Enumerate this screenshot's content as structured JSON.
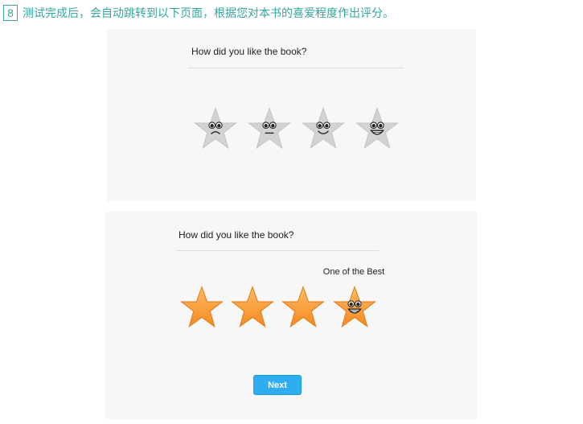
{
  "step": {
    "number": "8",
    "instruction": "测试完成后，会自动跳转到以下页面，根据您对本书的喜爱程度作出评分。"
  },
  "panel_before": {
    "question": "How did you like the book?",
    "rating": 0,
    "max_rating": 4,
    "star_color": "#d2d2d2",
    "faces": [
      "sad-face-icon",
      "neutral-face-icon",
      "smile-face-icon",
      "grin-face-icon"
    ]
  },
  "panel_after": {
    "question": "How did you like the book?",
    "rating": 4,
    "max_rating": 4,
    "star_color": "#ff9d3a",
    "selected_label": "One of the Best",
    "next_label": "Next"
  },
  "colors": {
    "accent_teal": "#35a59c",
    "button_blue": "#2eaef0",
    "panel_bg": "#f7f7f7"
  }
}
